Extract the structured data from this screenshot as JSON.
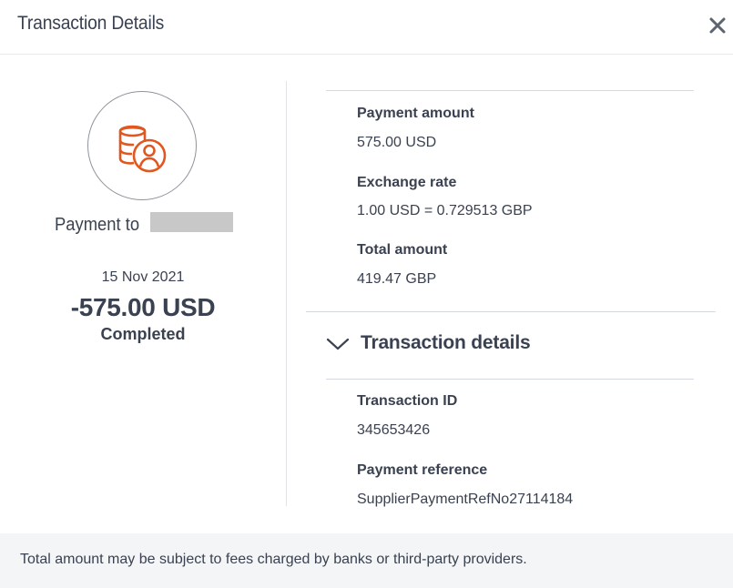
{
  "modal": {
    "title": "Transaction Details",
    "close_icon": "close-icon"
  },
  "summary": {
    "payee_prefix": "Payment to",
    "payee_name_redacted": true,
    "date": "15 Nov 2021",
    "amount": "-575.00 USD",
    "status": "Completed",
    "icon": "database-user-icon",
    "accent_color": "#e0571f"
  },
  "payment": {
    "amount_label": "Payment amount",
    "amount_value": "575.00 USD",
    "rate_label": "Exchange rate",
    "rate_value": "1.00 USD = 0.729513 GBP",
    "total_label": "Total amount",
    "total_value": "419.47 GBP"
  },
  "transaction_section": {
    "title": "Transaction details",
    "expanded": true,
    "toggle_icon": "chevron-down-icon",
    "id_label": "Transaction ID",
    "id_value": "345653426",
    "reference_label": "Payment reference",
    "reference_value": "SupplierPaymentRefNo27114184"
  },
  "footer": {
    "note": "Total amount may be subject to fees charged by banks or third-party providers."
  }
}
